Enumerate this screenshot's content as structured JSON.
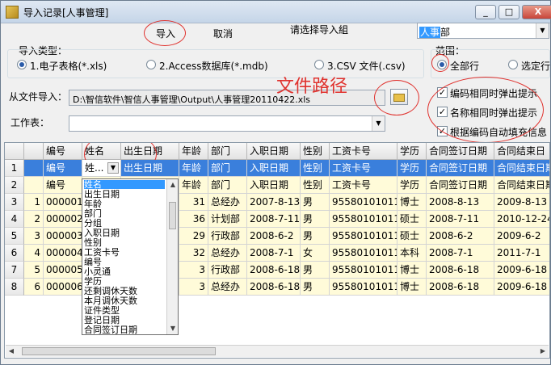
{
  "window": {
    "title": "导入记录[人事管理]",
    "minimize": "_",
    "maximize": "□",
    "close": "X"
  },
  "toolbar": {
    "import_label": "导入",
    "cancel_label": "取消"
  },
  "select_group": {
    "label": "请选择导入組",
    "value": "人事部",
    "value_highlight": "人事"
  },
  "import_type": {
    "label": "导入类型：",
    "options": [
      "1.电子表格(*.xls)",
      "2.Access数据库(*.mdb)",
      "3.CSV 文件(.csv)"
    ],
    "selected": 0
  },
  "scope": {
    "label": "范围：",
    "options": [
      "全部行",
      "选定行"
    ],
    "selected": 0
  },
  "file": {
    "label": "从文件导入：",
    "path": "D:\\智信软件\\智信人事管理\\Output\\人事管理20110422.xls"
  },
  "sheet": {
    "label": "工作表：",
    "value": ""
  },
  "annotation": {
    "text": "文件路径"
  },
  "options": [
    {
      "label": "编码相同时弹出提示",
      "checked": true
    },
    {
      "label": "名称相同时弹出提示",
      "checked": true
    },
    {
      "label": "根据编码自动填充信息",
      "checked": true
    }
  ],
  "grid": {
    "headers": [
      "编号",
      "姓名",
      "出生日期",
      "年龄",
      "部门",
      "入职日期",
      "性别",
      "工资卡号",
      "学历",
      "合同签订日期",
      "合同结束日"
    ],
    "mapping_row": [
      "编号",
      "姓名",
      "出生日期",
      "年龄",
      "部门",
      "入职日期",
      "性别",
      "工资卡号",
      "学历",
      "合同签订日期",
      "合同结束日期"
    ],
    "rows": [
      {
        "no": "1",
        "cells": [
          "",
          "",
          "",
          "",
          "",
          "",
          "",
          "",
          "",
          "",
          ""
        ]
      },
      {
        "no": "2",
        "cells": [
          "编号",
          "",
          "",
          "年龄",
          "部门",
          "入职日期",
          "性别",
          "工资卡号",
          "学历",
          "合同签订日期",
          "合同结束日期"
        ]
      },
      {
        "no": "3",
        "idx": "1",
        "cells": [
          "000001",
          "",
          "",
          "31",
          "总经办",
          "2007-8-13",
          "男",
          "955801010110",
          "博士",
          "2008-8-13",
          "2009-8-13"
        ]
      },
      {
        "no": "4",
        "idx": "2",
        "cells": [
          "000002",
          "",
          "",
          "36",
          "计划部",
          "2008-7-11",
          "男",
          "955801010111",
          "硕士",
          "2008-7-11",
          "2010-12-24"
        ]
      },
      {
        "no": "5",
        "idx": "3",
        "cells": [
          "000003",
          "",
          "",
          "29",
          "行政部",
          "2008-6-2",
          "男",
          "955801010113",
          "硕士",
          "2008-6-2",
          "2009-6-2"
        ]
      },
      {
        "no": "6",
        "idx": "4",
        "cells": [
          "000004",
          "",
          "",
          "32",
          "总经办",
          "2008-7-1",
          "女",
          "955801010115",
          "本科",
          "2008-7-1",
          "2011-7-1"
        ]
      },
      {
        "no": "7",
        "idx": "5",
        "cells": [
          "000005",
          "",
          "",
          "3",
          "行政部",
          "2008-6-18",
          "男",
          "955801010116",
          "博士",
          "2008-6-18",
          "2009-6-18"
        ]
      },
      {
        "no": "8",
        "idx": "6",
        "cells": [
          "000006",
          "",
          "",
          "3",
          "总经办",
          "2008-6-18",
          "男",
          "955801010116",
          "博士",
          "2008-6-18",
          "2009-6-18"
        ]
      }
    ],
    "editing_value": "姓..."
  },
  "dropdown": {
    "items": [
      "姓名",
      "出生日期",
      "年龄",
      "部门",
      "分组",
      "入职日期",
      "性别",
      "工资卡号",
      "编号",
      "小灵通",
      "学历",
      "还剩调休天数",
      "本月调休天数",
      "证件类型",
      "登记日期",
      "合同签订日期"
    ],
    "selected": 0
  }
}
